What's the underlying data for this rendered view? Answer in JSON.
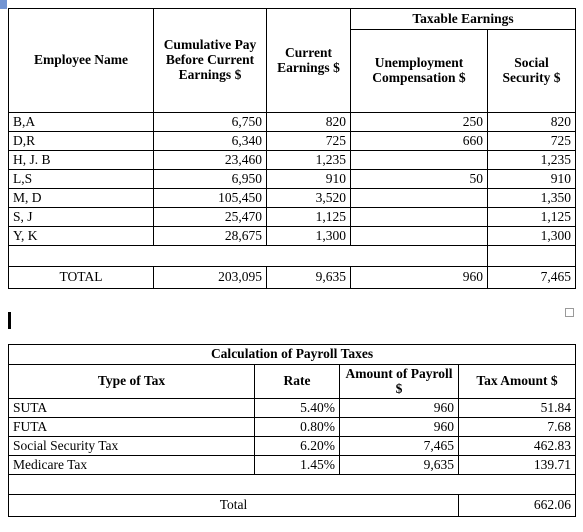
{
  "payroll_register": {
    "headers": {
      "employee_name": "Employee  Name",
      "cumulative_pay": "Cumulative Pay Before Current Earnings $",
      "current_earnings": "Current Earnings $",
      "taxable_earnings_group": "Taxable Earnings",
      "unemployment_compensation": "Unemployment Compensation $",
      "social_security": "Social Security $"
    },
    "rows": [
      {
        "name": "B,A",
        "cumulative_pay": "6,750",
        "current_earnings": "820",
        "unemployment": "250",
        "social_security": "820"
      },
      {
        "name": "D,R",
        "cumulative_pay": "6,340",
        "current_earnings": "725",
        "unemployment": "660",
        "social_security": "725"
      },
      {
        "name": "H, J. B",
        "cumulative_pay": "23,460",
        "current_earnings": "1,235",
        "unemployment": "",
        "social_security": "1,235"
      },
      {
        "name": "L,S",
        "cumulative_pay": "6,950",
        "current_earnings": "910",
        "unemployment": "50",
        "social_security": "910"
      },
      {
        "name": "M, D",
        "cumulative_pay": "105,450",
        "current_earnings": "3,520",
        "unemployment": "",
        "social_security": "1,350"
      },
      {
        "name": "S, J",
        "cumulative_pay": "25,470",
        "current_earnings": "1,125",
        "unemployment": "",
        "social_security": "1,125"
      },
      {
        "name": "Y, K",
        "cumulative_pay": "28,675",
        "current_earnings": "1,300",
        "unemployment": "",
        "social_security": "1,300"
      }
    ],
    "total": {
      "label": "TOTAL",
      "cumulative_pay": "203,095",
      "current_earnings": "9,635",
      "unemployment": "960",
      "social_security": "7,465"
    }
  },
  "payroll_taxes": {
    "title": "Calculation of Payroll Taxes",
    "headers": {
      "type_of_tax": "Type of Tax",
      "rate": "Rate",
      "amount_of_payroll": "Amount of Payroll $",
      "tax_amount": "Tax Amount $"
    },
    "rows": [
      {
        "type": "SUTA",
        "rate": "5.40%",
        "amount_of_payroll": "960",
        "tax_amount": "51.84"
      },
      {
        "type": "FUTA",
        "rate": "0.80%",
        "amount_of_payroll": "960",
        "tax_amount": "7.68"
      },
      {
        "type": "Social Security Tax",
        "rate": "6.20%",
        "amount_of_payroll": "7,465",
        "tax_amount": "462.83"
      },
      {
        "type": "Medicare Tax",
        "rate": "1.45%",
        "amount_of_payroll": "9,635",
        "tax_amount": "139.71"
      }
    ],
    "total": {
      "label": "Total",
      "tax_amount": "662.06"
    }
  }
}
